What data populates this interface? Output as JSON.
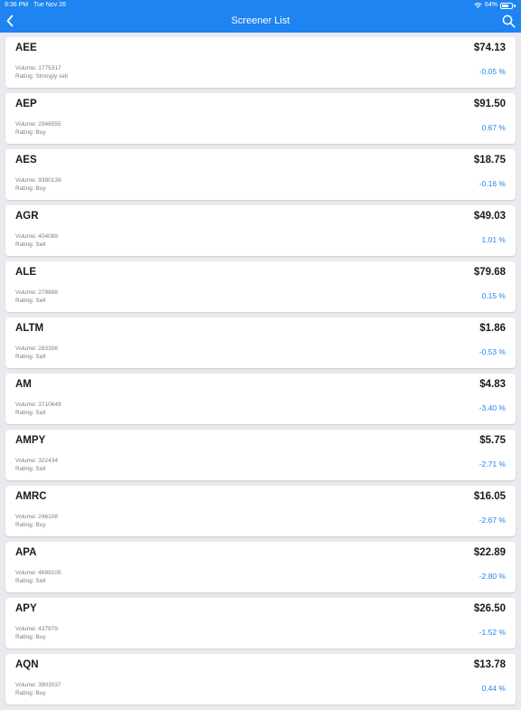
{
  "status": {
    "time": "9:36 PM",
    "date": "Tue Nov 26",
    "battery": "64%"
  },
  "nav": {
    "title": "Screener List",
    "back_icon": "chevron-left-icon",
    "search_icon": "search-icon"
  },
  "colors": {
    "accent": "#1d84f2",
    "background": "#e9e9ef"
  },
  "stocks": [
    {
      "symbol": "AEE",
      "price": "$74.13",
      "volume": "Volume: 1775317",
      "rating": "Rating: Strongly sell",
      "change": "-0.05 %"
    },
    {
      "symbol": "AEP",
      "price": "$91.50",
      "volume": "Volume: 2946555",
      "rating": "Rating: Buy",
      "change": "0.67 %"
    },
    {
      "symbol": "AES",
      "price": "$18.75",
      "volume": "Volume: 9390139",
      "rating": "Rating: Buy",
      "change": "-0.16 %"
    },
    {
      "symbol": "AGR",
      "price": "$49.03",
      "volume": "Volume: 404089",
      "rating": "Rating: Sell",
      "change": "1.01 %"
    },
    {
      "symbol": "ALE",
      "price": "$79.68",
      "volume": "Volume: 279888",
      "rating": "Rating: Sell",
      "change": "0.15 %"
    },
    {
      "symbol": "ALTM",
      "price": "$1.86",
      "volume": "Volume: 283306",
      "rating": "Rating: Sell",
      "change": "-0.53 %"
    },
    {
      "symbol": "AM",
      "price": "$4.83",
      "volume": "Volume: 3710649",
      "rating": "Rating: Sell",
      "change": "-3.40 %"
    },
    {
      "symbol": "AMPY",
      "price": "$5.75",
      "volume": "Volume: 322434",
      "rating": "Rating: Sell",
      "change": "-2.71 %"
    },
    {
      "symbol": "AMRC",
      "price": "$16.05",
      "volume": "Volume: 246108",
      "rating": "Rating: Buy",
      "change": "-2.67 %"
    },
    {
      "symbol": "APA",
      "price": "$22.89",
      "volume": "Volume: 4699105",
      "rating": "Rating: Sell",
      "change": "-2.80 %"
    },
    {
      "symbol": "APY",
      "price": "$26.50",
      "volume": "Volume: 437879",
      "rating": "Rating: Buy",
      "change": "-1.52 %"
    },
    {
      "symbol": "AQN",
      "price": "$13.78",
      "volume": "Volume: 3903037",
      "rating": "Rating: Buy",
      "change": "0.44 %"
    }
  ]
}
